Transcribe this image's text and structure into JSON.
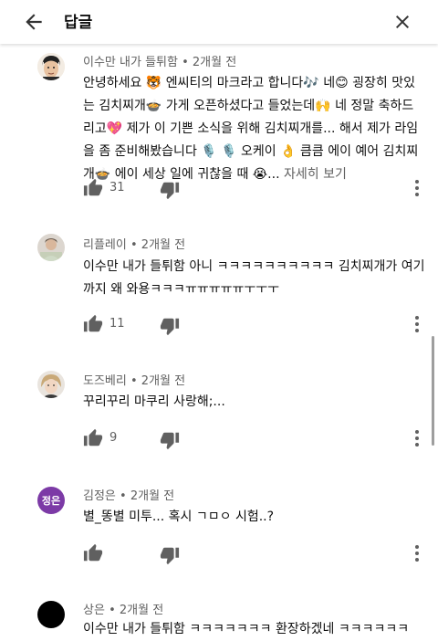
{
  "header": {
    "title": "답글"
  },
  "comments": [
    {
      "author": "이수만 내가 들튀함",
      "time": "2개월 전",
      "text": "안녕하세요 🐯 엔씨티의 마크라고 합니다🎶 네😊 굉장히 맛있는 김치찌개🍲 가게 오픈하셨다고 들었는데🙌 네 정말 축하드리고💖 제가 이 기쁜 소식을 위해 김치찌개를... 해서 제가 라임을 좀 준비해봤습니다 🎙️ 🎙️ 오케이 👌 큼큼 에이 예어 김치찌개🍲 에이 세상 일에 귀찮을 때 😭...",
      "more": "자세히 보기",
      "likes": "31"
    },
    {
      "author": "리플레이",
      "time": "2개월 전",
      "text": "이수만 내가 들튀함 아니 ㅋㅋㅋㅋㅋㅋㅋㅋㅋㅋ 김치찌개가 여기까지 왜 와용ㅋㅋㅋㅠㅠㅠㅠㅠㅜㅜㅜ",
      "likes": "11"
    },
    {
      "author": "도즈베리",
      "time": "2개월 전",
      "text": "꾸리꾸리 마쿠리 사랑해;...",
      "likes": "9"
    },
    {
      "author": "김정은",
      "avatar_text": "정은",
      "time": "2개월 전",
      "text": "별_똥별 미투... 혹시 ㄱㅁㅇ 시험..?",
      "likes": ""
    },
    {
      "author": "상은",
      "time": "2개월 전",
      "text": "이수만 내가 들튀함 ㅋㅋㅋㅋㅋㅋㅋ 환장하겠네 ㅋㅋㅋㅋㅋㅋ"
    }
  ],
  "meta_separator": "•",
  "colors": {
    "secondary_text": "#606060",
    "avatar_purple": "#7c3aa6"
  }
}
